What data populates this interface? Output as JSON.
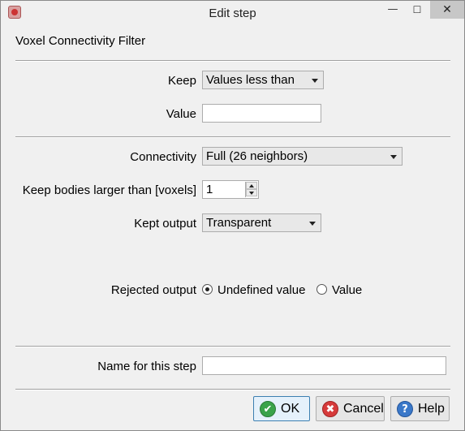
{
  "window": {
    "title": "Edit step",
    "minimize_glyph": "—",
    "maximize_glyph": "☐",
    "close_glyph": "✕"
  },
  "filter_title": "Voxel Connectivity Filter",
  "keep": {
    "label": "Keep",
    "selected": "Values less than"
  },
  "value": {
    "label": "Value",
    "value": ""
  },
  "connectivity": {
    "label": "Connectivity",
    "selected": "Full (26 neighbors)"
  },
  "min_size": {
    "label": "Keep bodies larger than [voxels]",
    "value": "1"
  },
  "kept_output": {
    "label": "Kept output",
    "selected": "Transparent"
  },
  "rejected_output": {
    "label": "Rejected output",
    "options": [
      {
        "label": "Undefined value",
        "checked": true
      },
      {
        "label": "Value",
        "checked": false
      }
    ]
  },
  "step_name": {
    "label": "Name for this step",
    "value": ""
  },
  "buttons": {
    "ok": {
      "label": "OK",
      "icon": "check-icon",
      "glyph": "✔"
    },
    "cancel": {
      "label": "Cancel",
      "icon": "cancel-icon",
      "glyph": "✖"
    },
    "help": {
      "label": "Help",
      "icon": "help-icon",
      "glyph": "?"
    }
  }
}
